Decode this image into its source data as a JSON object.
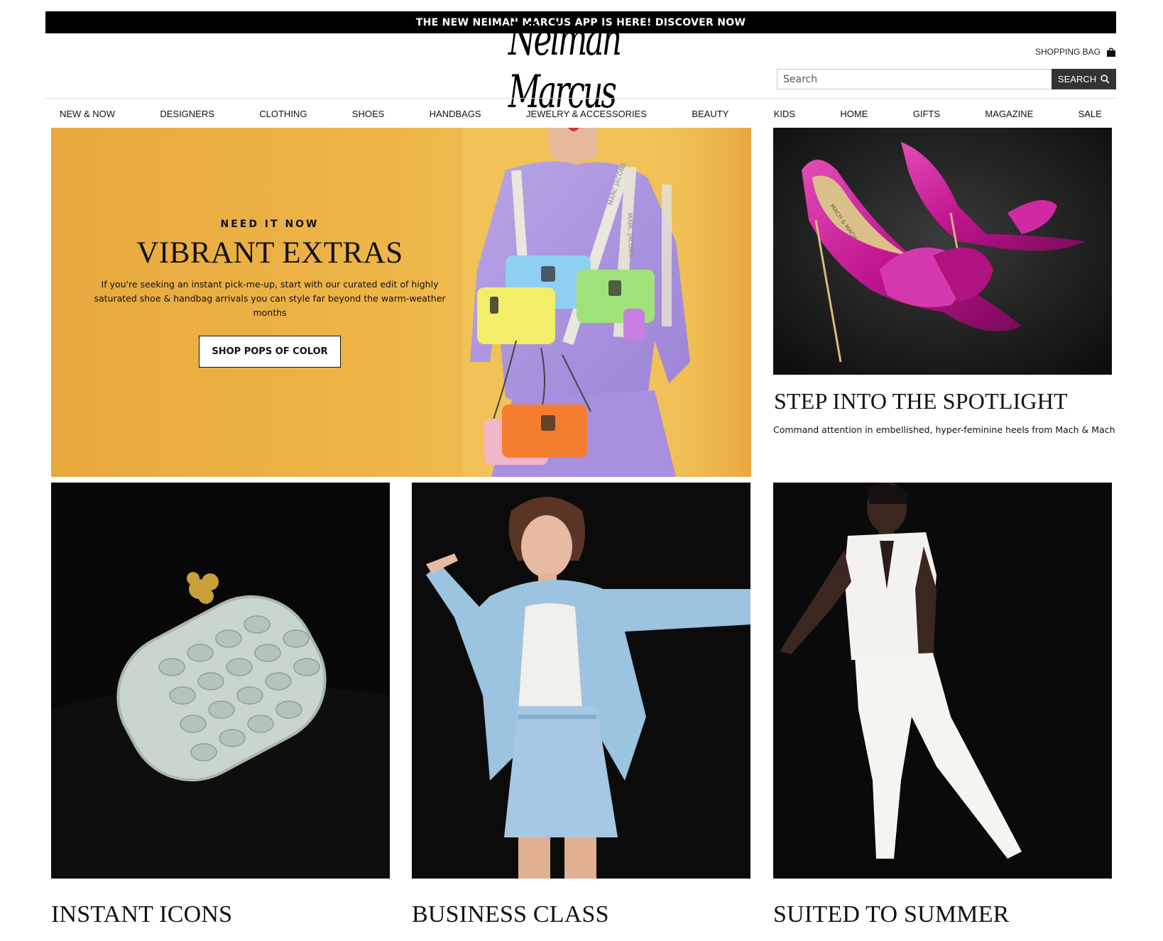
{
  "promo_banner": {
    "text": "THE NEW NEIMAN MARCUS APP IS HERE! DISCOVER NOW"
  },
  "header": {
    "logo_text": "Neiman Marcus",
    "shopping_bag_label": "SHOPPING BAG",
    "search": {
      "placeholder": "Search",
      "button_label": "SEARCH"
    }
  },
  "nav": {
    "items": [
      {
        "label": "NEW & NOW"
      },
      {
        "label": "DESIGNERS"
      },
      {
        "label": "CLOTHING"
      },
      {
        "label": "SHOES"
      },
      {
        "label": "HANDBAGS"
      },
      {
        "label": "JEWELRY & ACCESSORIES"
      },
      {
        "label": "BEAUTY"
      },
      {
        "label": "KIDS"
      },
      {
        "label": "HOME"
      },
      {
        "label": "GIFTS"
      },
      {
        "label": "MAGAZINE"
      },
      {
        "label": "SALE"
      }
    ]
  },
  "hero": {
    "eyebrow": "NEED IT NOW",
    "title": "VIBRANT EXTRAS",
    "description": "If you're seeking an instant pick-me-up, start with our curated edit of highly saturated shoe & handbag arrivals you can style far beyond the warm-weather months",
    "cta_label": "SHOP POPS OF COLOR",
    "strap_text": "MARC JACOBS"
  },
  "spotlight": {
    "title": "STEP INTO THE SPOTLIGHT",
    "subtitle": "Command attention in embellished, hyper-feminine heels from Mach & Mach",
    "insole_text": "MACH & MACH"
  },
  "tiles": [
    {
      "title": "INSTANT ICONS"
    },
    {
      "title": "BUSINESS CLASS"
    },
    {
      "title": "SUITED TO SUMMER"
    }
  ],
  "colors": {
    "hero_bg": "#edb447",
    "accent_black": "#000000",
    "search_button": "#333333",
    "heel_magenta": "#c0148f"
  },
  "icons": {
    "bag": "shopping-bag-icon",
    "search": "search-icon"
  }
}
